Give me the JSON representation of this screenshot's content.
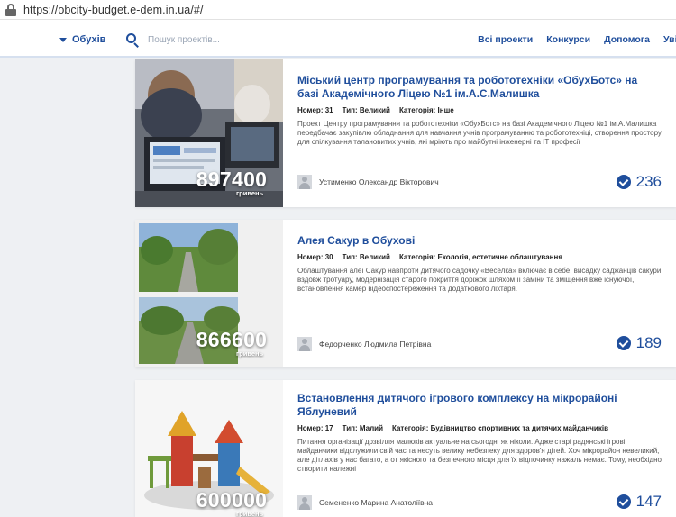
{
  "browser": {
    "url": "https://obcity-budget.e-dem.in.ua/#/"
  },
  "nav": {
    "city": "Обухів",
    "search_placeholder": "Пошук проектів...",
    "links": [
      "Всі проекти",
      "Конкурси",
      "Допомога",
      "Увійти"
    ]
  },
  "labels": {
    "number": "Номер:",
    "type": "Тип:",
    "category": "Категорія:",
    "currency": "гривень"
  },
  "projects": [
    {
      "title": "Міський центр програмування та робототехніки «ОбухБотс» на базі Академічного Ліцею №1 ім.А.С.Малишка",
      "number": "31",
      "type": "Великий",
      "category": "Інше",
      "description": "Проект Центру програмування та робототехніки «ОбухБотс» на базі Академічного Ліцею №1 ім.А.Малишка передбачає закупівлю обладнання для навчання учнів програмуванню та робототехніці, створення простору для спілкування талановитих учнів, які мріють про майбутні інженерні та ІТ професії",
      "amount": "897400",
      "author": "Устименко Олександр Вікторович",
      "votes": "236"
    },
    {
      "title": "Алея Сакур в Обухові",
      "number": "30",
      "type": "Великий",
      "category": "Екологія, естетичне облаштування",
      "description": "Облаштування алеї Сакур навпроти дитячого садочку «Веселка» включає в себе: висадку саджанців сакури вздовж тротуару, модернізація старого покриття доріжок шляхом її заміни та зміщення вже існуючої, встановлення камер відеоспостереження та додаткового ліхтаря.",
      "amount": "866600",
      "author": "Федорченко Людмила Петрівна",
      "votes": "189"
    },
    {
      "title": "Встановлення дитячого ігрового комплексу на мікрорайоні Яблуневий",
      "number": "17",
      "type": "Малий",
      "category": "Будівництво спортивних та дитячих майданчиків",
      "description": "Питання організації дозвілля малюків актуальне на сьогодні як ніколи. Адже старі радянські ігрові майданчики відслужили свій час та несуть велику небезпеку для здоров'я дітей. Хоч мікрорайон невеликий, але дітлахів у нас багато, а от якісного та безпечного місця для їх відпочинку нажаль немає. Тому, необхідно створити належні",
      "amount": "600000",
      "author": "Семененко Марина Анатоліївна",
      "votes": "147"
    }
  ]
}
